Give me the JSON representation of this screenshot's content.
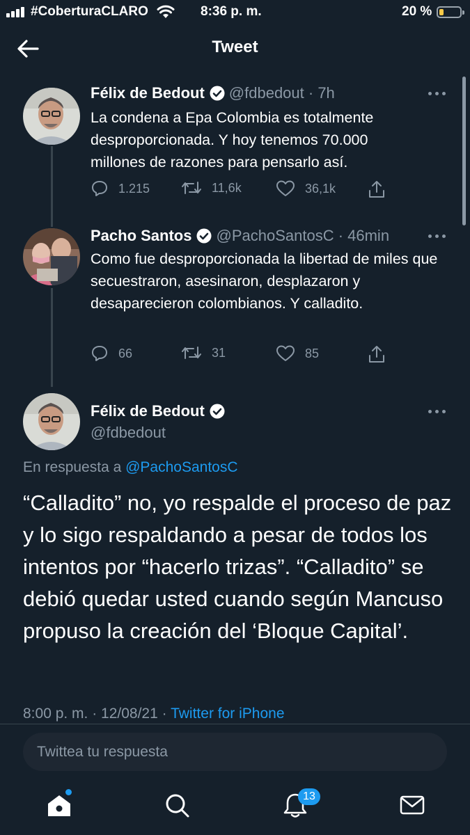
{
  "status_bar": {
    "carrier": "#CoberturaCLARO",
    "time": "8:36 p. m.",
    "battery": "20 %"
  },
  "header": {
    "title": "Tweet"
  },
  "tweets": [
    {
      "name": "Félix de Bedout",
      "handle_time": "@fdbedout · 7h",
      "text": "La condena a Epa Colombia es totalmente desproporcionada. Y hoy tenemos 70.000 millones de razones para pensarlo así.",
      "replies": "1.215",
      "retweets": "11,6k",
      "likes": "36,1k"
    },
    {
      "name": "Pacho Santos",
      "handle_time": "@PachoSantosC · 46min",
      "text": "Como fue desproporcionada la libertad de miles que secuestraron, asesinaron, desplazaron y desaparecieron colombianos. Y calladito.",
      "replies": "66",
      "retweets": "31",
      "likes": "85"
    }
  ],
  "main_tweet": {
    "name": "Félix de Bedout",
    "handle": "@fdbedout",
    "reply_prefix": "En respuesta a",
    "reply_handle": "@PachoSantosC",
    "text": "“Calladito” no, yo respalde el proceso de paz y lo sigo respaldando a pesar de todos los intentos por “hacerlo trizas”. “Calladito” se debió quedar usted cuando según Mancuso propuso la creación del ‘Bloque Capital’.",
    "datetime": "8:00 p. m. · 12/08/21 ·",
    "source": "Twitter for iPhone"
  },
  "reply_bar": {
    "placeholder": "Twittea tu respuesta"
  },
  "tab_bar": {
    "notifications_badge": "13"
  },
  "colors": {
    "background": "#15202b",
    "accent": "#1d9bf0",
    "muted": "#8b98a5"
  }
}
